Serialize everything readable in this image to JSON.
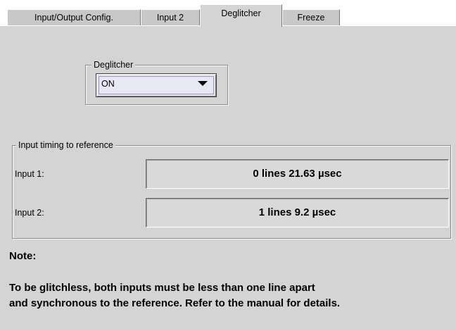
{
  "tabs": [
    {
      "label": "Input/Output Config.",
      "active": false
    },
    {
      "label": "Input 2",
      "active": false
    },
    {
      "label": "Deglitcher",
      "active": true
    },
    {
      "label": "Freeze",
      "active": false
    }
  ],
  "deglitcher": {
    "group_title": "Deglitcher",
    "selected_value": "ON",
    "icon": "chevron-down-icon"
  },
  "timing": {
    "group_title": "Input timing to reference",
    "rows": [
      {
        "label": "Input 1:",
        "value": "0 lines 21.63 µsec"
      },
      {
        "label": "Input 2:",
        "value": "1 lines 9.2 µsec"
      }
    ]
  },
  "note": {
    "heading": "Note:",
    "line1": "To be glitchless, both inputs must be less than one line apart",
    "line2": "and synchronous to the reference. Refer to the manual for details."
  },
  "colors": {
    "panel_bg": "#d4d4d4",
    "select_bg": "#e6e6f2"
  }
}
